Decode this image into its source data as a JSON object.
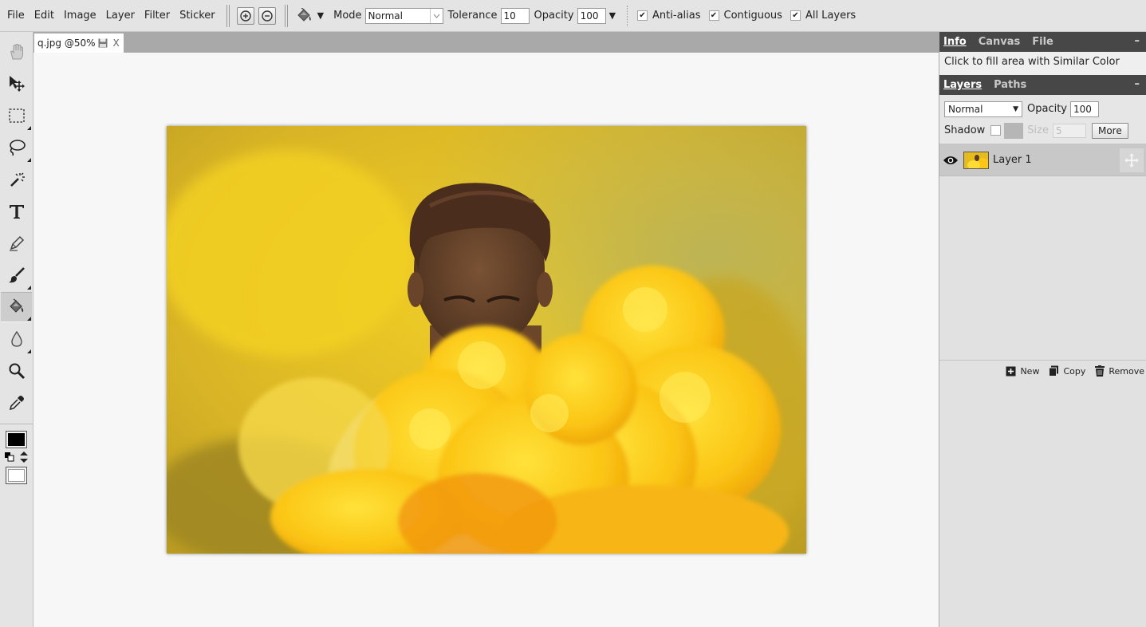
{
  "menu": {
    "items": [
      "File",
      "Edit",
      "Image",
      "Layer",
      "Filter",
      "Sticker"
    ]
  },
  "options": {
    "mode_label": "Mode",
    "mode_value": "Normal",
    "tolerance_label": "Tolerance",
    "tolerance_value": "10",
    "opacity_label": "Opacity",
    "opacity_value": "100",
    "anti_alias_label": "Anti-alias",
    "contiguous_label": "Contiguous",
    "all_layers_label": "All Layers",
    "anti_alias_checked": true,
    "contiguous_checked": true,
    "all_layers_checked": true
  },
  "document": {
    "tab_title": "q.jpg @50%",
    "close_label": "X"
  },
  "tools": [
    "hand-icon",
    "move-icon",
    "rect-select-icon",
    "lasso-icon",
    "magic-wand-icon",
    "text-icon",
    "pen-icon",
    "brush-icon",
    "paint-bucket-icon",
    "blur-drop-icon",
    "zoom-icon",
    "eyedropper-icon"
  ],
  "active_tool": "paint-bucket-icon",
  "colors": {
    "foreground": "#000000",
    "background": "#ffffff",
    "panel_header": "#474747"
  },
  "info_panel": {
    "tabs": [
      "Info",
      "Canvas",
      "File"
    ],
    "active_tab": "Info",
    "collapse": "–",
    "message": "Click to fill area with Similar Color"
  },
  "layers_panel": {
    "tabs": [
      "Layers",
      "Paths"
    ],
    "active_tab": "Layers",
    "collapse": "–",
    "blend_mode": "Normal",
    "opacity_label": "Opacity",
    "opacity_value": "100",
    "shadow_label": "Shadow",
    "size_label": "Size",
    "size_value": "5",
    "more_label": "More",
    "layers": [
      {
        "name": "Layer 1",
        "visible": true
      }
    ],
    "actions": [
      "New",
      "Copy",
      "Remove"
    ]
  }
}
